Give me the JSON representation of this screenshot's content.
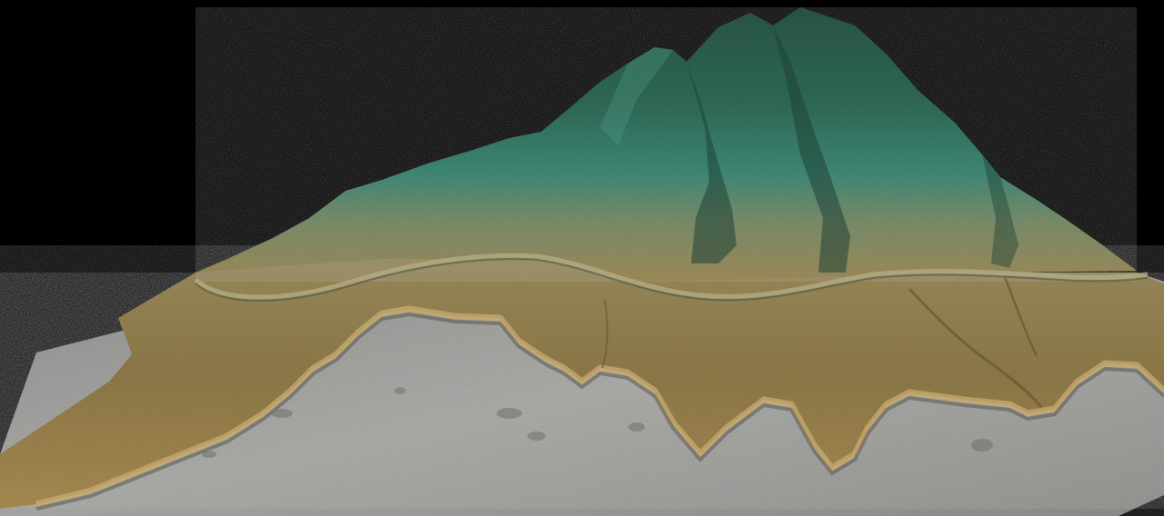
{
  "scene": {
    "background_color": "#000000",
    "view": "3d-terrain-oblique",
    "shading": "hillshade",
    "palette": {
      "lowland_gray": "#9c9c9a",
      "lowland_gray_light": "#b8b8b5",
      "lowland_gray_dark": "#6e6e6c",
      "escarpment_tan": "#a98a52",
      "plain_olive": "#8a7a4a",
      "plain_olive_light": "#a2925e",
      "slope_teal": "#3f8f7f",
      "summit_green": "#2f5e48",
      "summit_green_dark": "#213f33"
    }
  }
}
